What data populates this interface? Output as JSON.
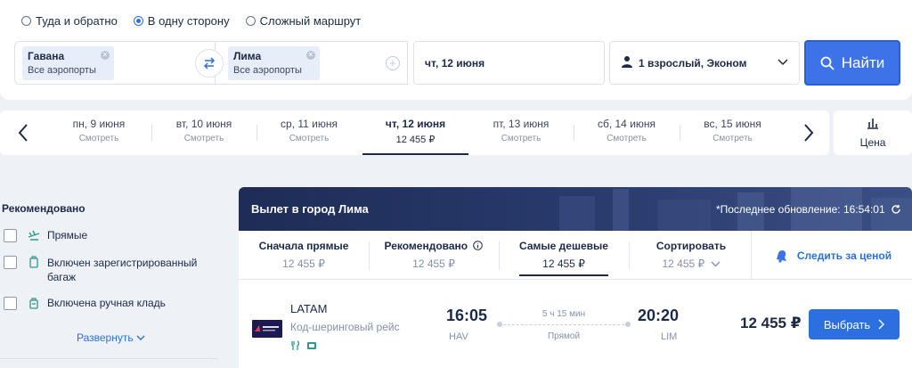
{
  "trip_types": [
    {
      "label": "Туда и обратно",
      "checked": false
    },
    {
      "label": "В одну сторону",
      "checked": true
    },
    {
      "label": "Сложный маршрут",
      "checked": false
    }
  ],
  "search": {
    "from": {
      "city": "Гавана",
      "airports": "Все аэропорты"
    },
    "to": {
      "city": "Лима",
      "airports": "Все аэропорты"
    },
    "date": "чт, 12 июня",
    "passengers": "1 взрослый, Эконом",
    "button": "Найти"
  },
  "date_carousel": {
    "days": [
      {
        "label": "пн, 9 июня",
        "sub": "Смотреть"
      },
      {
        "label": "вт, 10 июня",
        "sub": "Смотреть"
      },
      {
        "label": "ср, 11 июня",
        "sub": "Смотреть"
      },
      {
        "label": "чт, 12 июня",
        "sub": "12 455 ₽",
        "active": true
      },
      {
        "label": "пт, 13 июня",
        "sub": "Смотреть"
      },
      {
        "label": "сб, 14 июня",
        "sub": "Смотреть"
      },
      {
        "label": "вс, 15 июня",
        "sub": "Смотреть"
      }
    ],
    "price_sort_label": "Цена"
  },
  "filters": {
    "title": "Рекомендовано",
    "items": [
      {
        "label": "Прямые",
        "icon": "plane-icon"
      },
      {
        "label": "Включен зарегистрированный багаж",
        "icon": "suitcase-icon"
      },
      {
        "label": "Включена ручная кладь",
        "icon": "carry-on-bag-icon"
      }
    ],
    "expand": "Развернуть"
  },
  "results": {
    "title": "Вылет в город Лима",
    "last_update": "*Последнее обновление: 16:54:01",
    "sort": [
      {
        "label": "Сначала прямые",
        "price": "12 455 ₽"
      },
      {
        "label": "Рекомендовано",
        "price": "12 455 ₽"
      },
      {
        "label": "Самые дешевые",
        "price": "12 455 ₽",
        "active": true
      },
      {
        "label": "Сортировать",
        "price": "12 455 ₽"
      }
    ],
    "track_price": "Следить за ценой",
    "flight": {
      "airline": "LATAM",
      "note": "Код-шеринговый рейс",
      "dep_time": "16:05",
      "dep_code": "HAV",
      "duration": "5 ч 15 мин",
      "stops": "Прямой",
      "arr_time": "20:20",
      "arr_code": "LIM",
      "price": "12 455 ₽",
      "select": "Выбрать"
    }
  },
  "colors": {
    "accent": "#3d72e8",
    "dark": "#1c2a48",
    "hero": "#1e2c56"
  }
}
